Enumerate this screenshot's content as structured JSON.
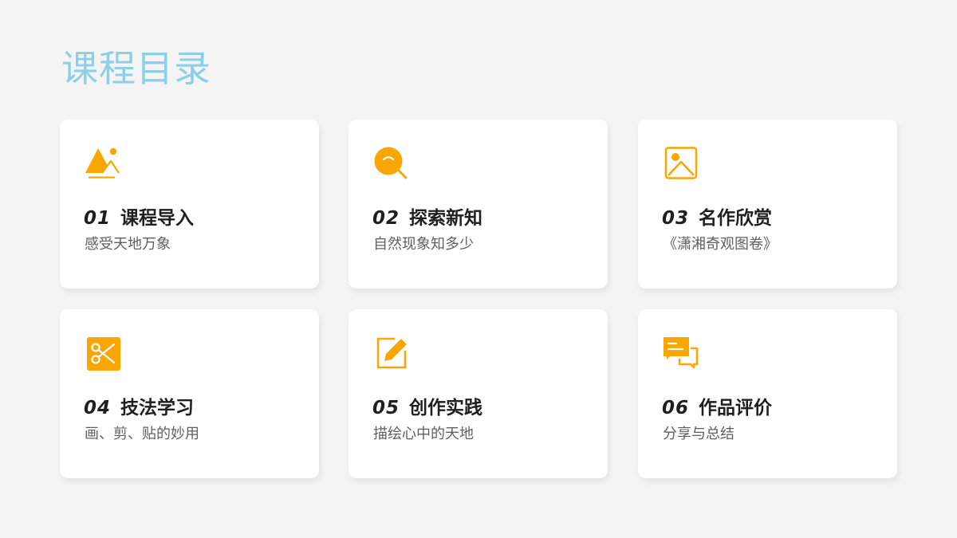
{
  "page": {
    "title": "课程目录"
  },
  "colors": {
    "title": "#8ecfe8",
    "accent": "#f9a600",
    "card_background": "#ffffff",
    "page_background": "#f4f4f4",
    "heading_text": "#1f1f1f",
    "subtitle_text": "#5f5f5f"
  },
  "cards": [
    {
      "number": "01",
      "title": "课程导入",
      "subtitle": "感受天地万象",
      "icon": "landscape-icon"
    },
    {
      "number": "02",
      "title": "探索新知",
      "subtitle": "自然现象知多少",
      "icon": "magnifier-icon"
    },
    {
      "number": "03",
      "title": "名作欣赏",
      "subtitle": "《潇湘奇观图卷》",
      "icon": "picture-icon"
    },
    {
      "number": "04",
      "title": "技法学习",
      "subtitle": "画、剪、贴的妙用",
      "icon": "scissors-icon"
    },
    {
      "number": "05",
      "title": "创作实践",
      "subtitle": "描绘心中的天地",
      "icon": "edit-icon"
    },
    {
      "number": "06",
      "title": "作品评价",
      "subtitle": "分享与总结",
      "icon": "comment-icon"
    }
  ]
}
